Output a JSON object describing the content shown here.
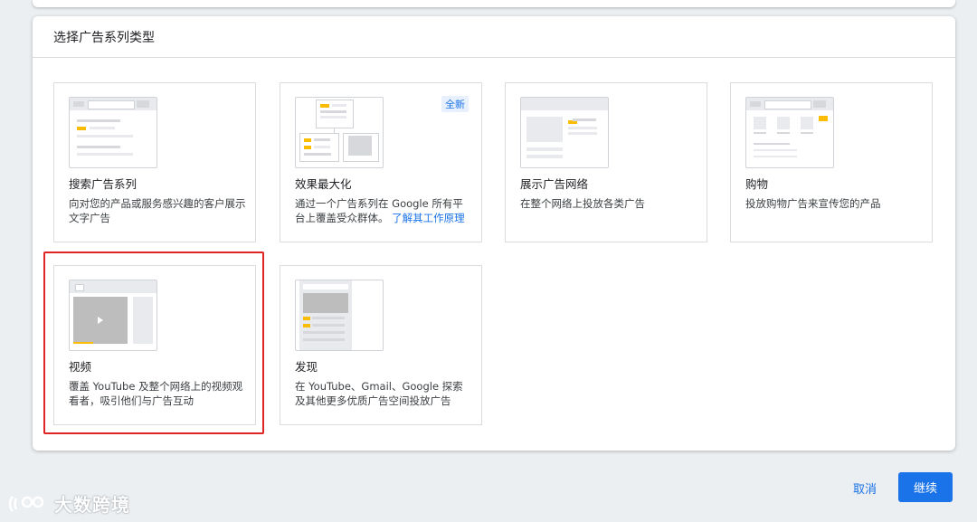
{
  "dialog": {
    "title": "选择广告系列类型"
  },
  "cards": [
    {
      "title": "搜索广告系列",
      "desc": "向对您的产品或服务感兴趣的客户展示文字广告"
    },
    {
      "title": "效果最大化",
      "desc": "通过一个广告系列在 Google 所有平台上覆盖受众群体。",
      "link": "了解其工作原理",
      "badge": "全新"
    },
    {
      "title": "展示广告网络",
      "desc": "在整个网络上投放各类广告"
    },
    {
      "title": "购物",
      "desc": "投放购物广告来宣传您的产品"
    },
    {
      "title": "视频",
      "desc": "覆盖 YouTube 及整个网络上的视频观看者，吸引他们与广告互动"
    },
    {
      "title": "发现",
      "desc": "在 YouTube、Gmail、Google 探索及其他更多优质广告空间投放广告"
    }
  ],
  "actions": {
    "cancel": "取消",
    "continue": "继续"
  },
  "watermark": "大数跨境",
  "colors": {
    "accent": "#1a73e8",
    "highlight": "#fbbc04",
    "selection": "#e02323"
  }
}
